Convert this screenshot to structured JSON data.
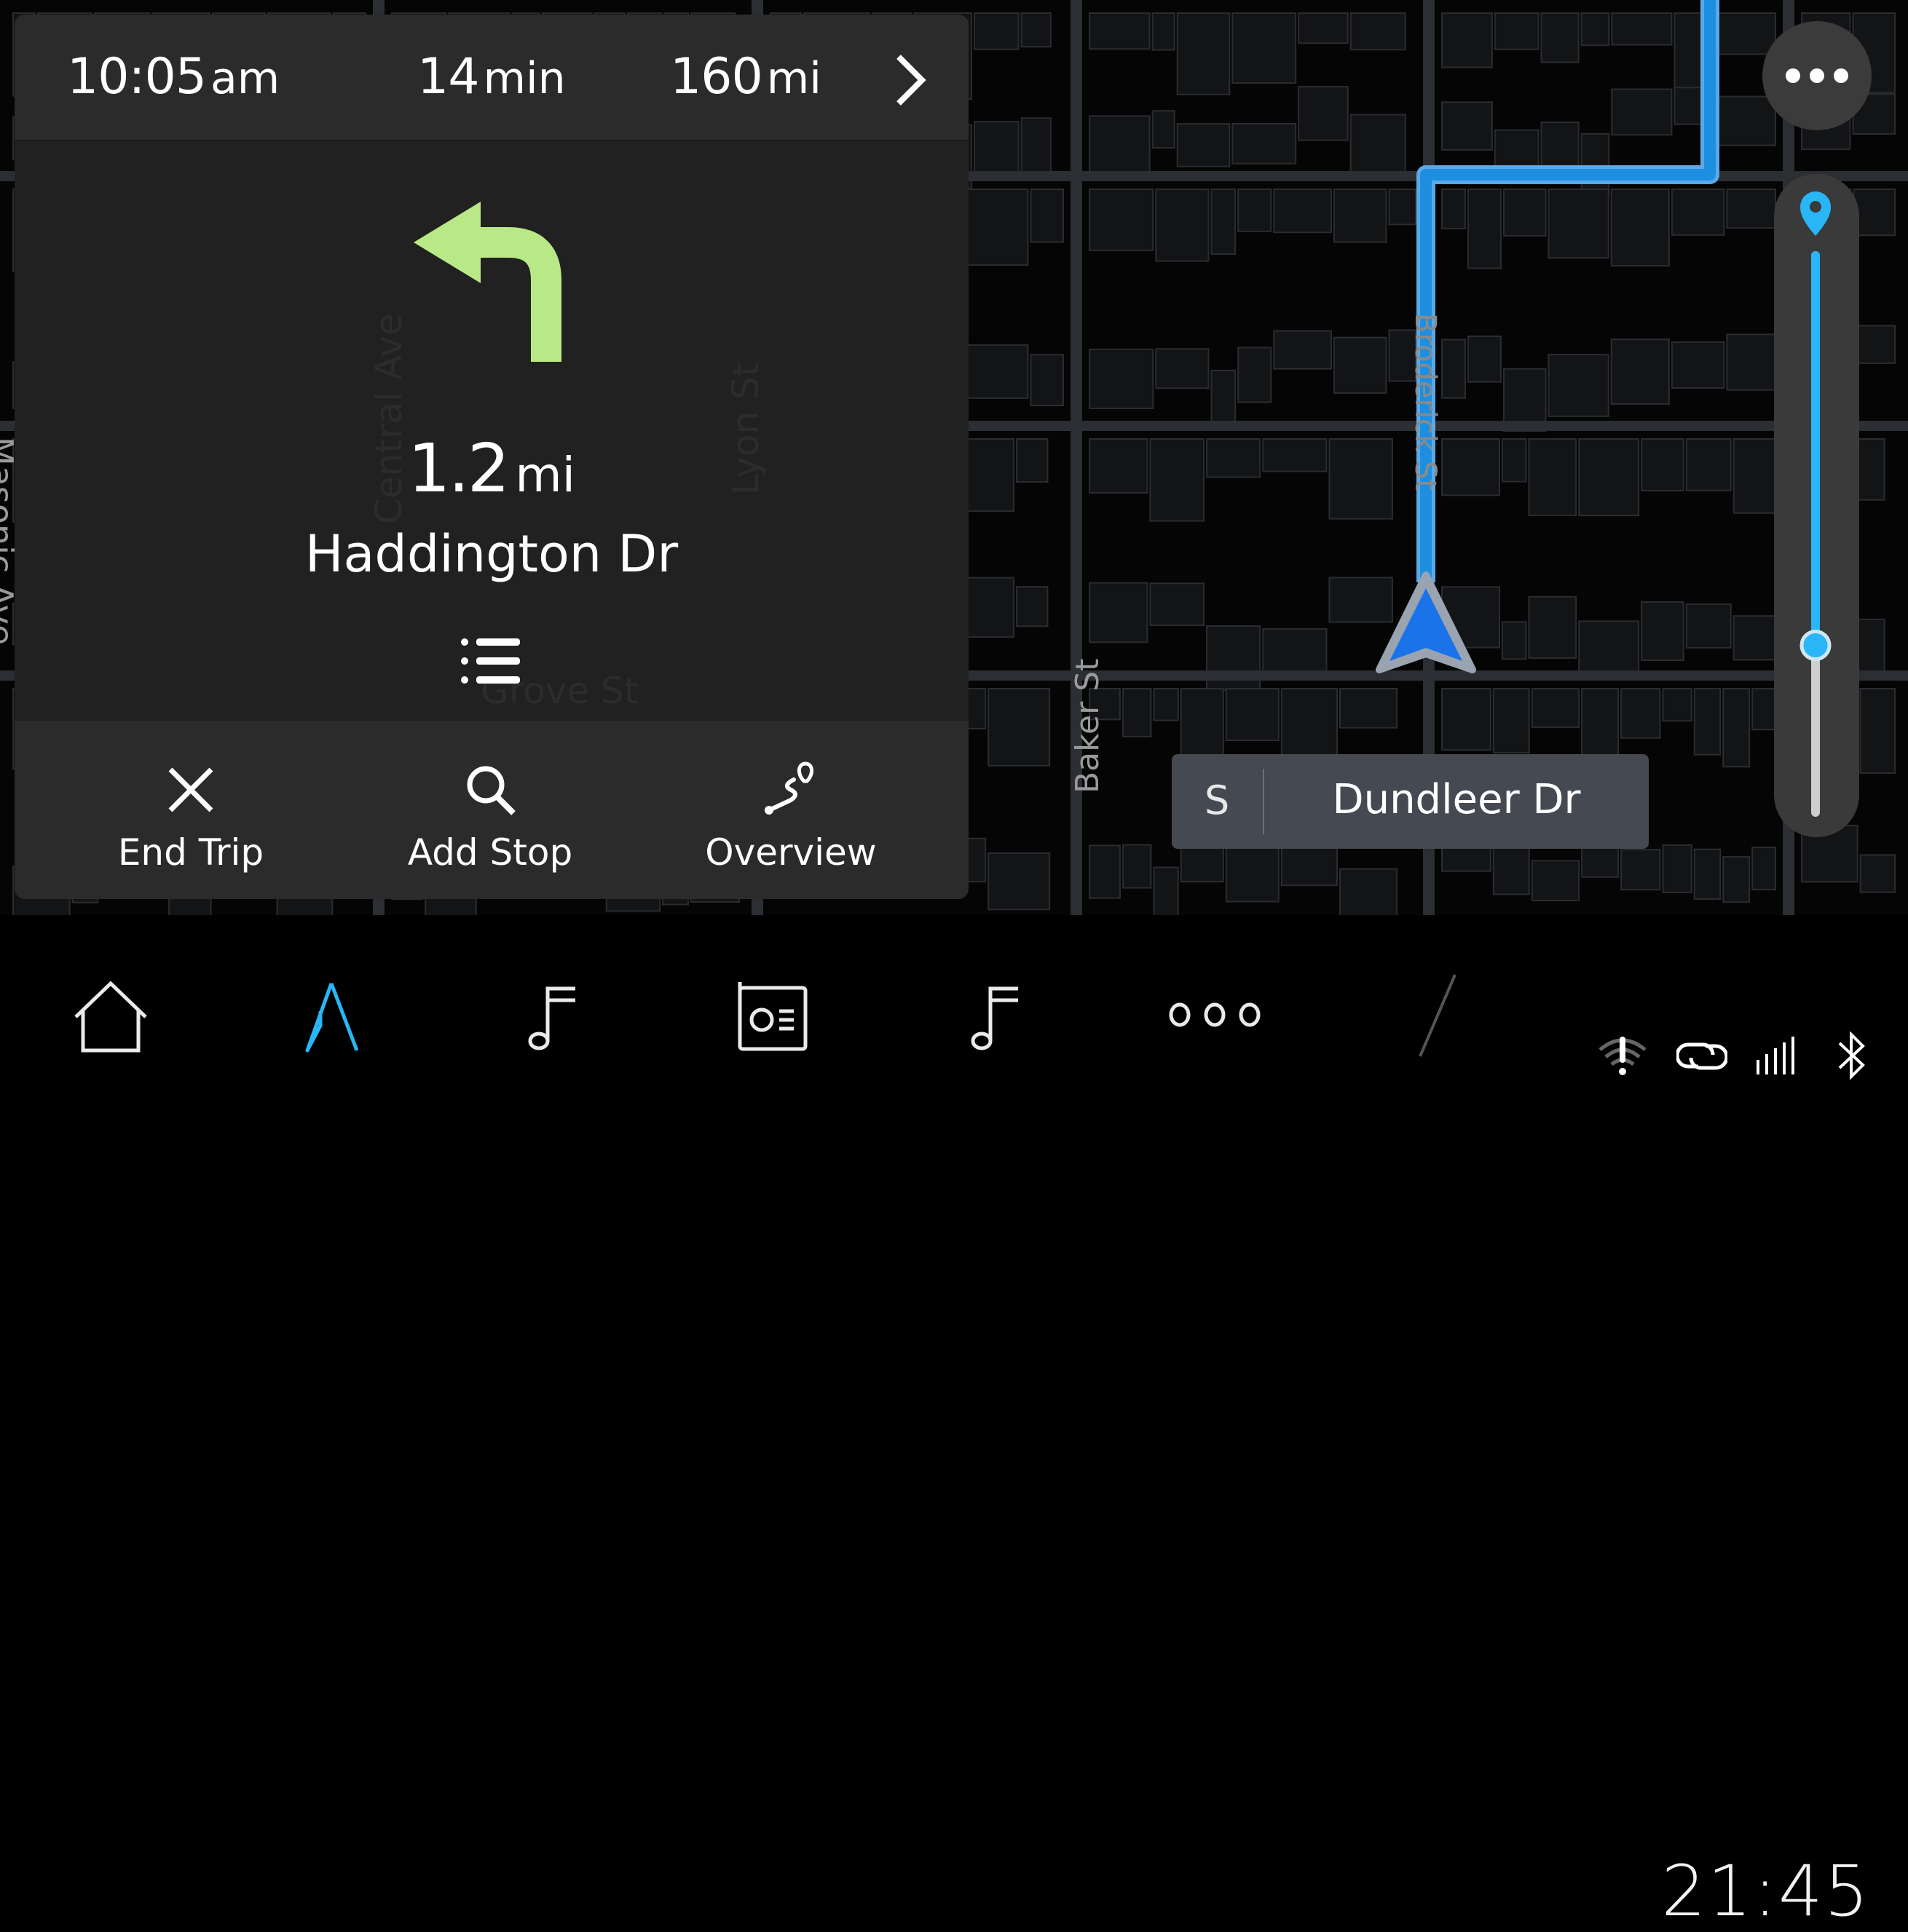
{
  "trip": {
    "arrival_time": "10:05",
    "arrival_suffix": "am",
    "remaining_time": "14",
    "remaining_time_unit": "min",
    "remaining_distance": "160",
    "remaining_distance_unit": "mi"
  },
  "maneuver": {
    "type": "turn-left",
    "distance": "1.2",
    "distance_unit": "mi",
    "street": "Haddington Dr",
    "arrow_color": "#b8e986"
  },
  "actions": [
    {
      "label": "End Trip",
      "icon": "close-icon"
    },
    {
      "label": "Add Stop",
      "icon": "search-icon"
    },
    {
      "label": "Overview",
      "icon": "route-overview-icon"
    }
  ],
  "current_road": {
    "direction": "S",
    "name": "Dundleer Dr"
  },
  "map_labels": {
    "masonic": "Masonic Ave",
    "central": "Central Ave",
    "lyon": "Lyon St",
    "grove": "Grove St",
    "baker": "Baker St",
    "broderick": "Broderick St"
  },
  "zoom_level": 0.3,
  "colors": {
    "route": "#1e8fe0",
    "accent": "#29b6f6",
    "turn_arrow": "#b8e986"
  },
  "bottom_nav": [
    {
      "icon": "home-icon"
    },
    {
      "icon": "navigation-icon",
      "active": true
    },
    {
      "icon": "music-icon"
    },
    {
      "icon": "radio-icon"
    },
    {
      "icon": "music-icon"
    },
    {
      "icon": "more-apps-icon"
    }
  ],
  "status": {
    "time": "21:45",
    "icons": [
      "wifi-alert-icon",
      "connected-link-icon",
      "signal-icon",
      "bluetooth-icon"
    ]
  }
}
